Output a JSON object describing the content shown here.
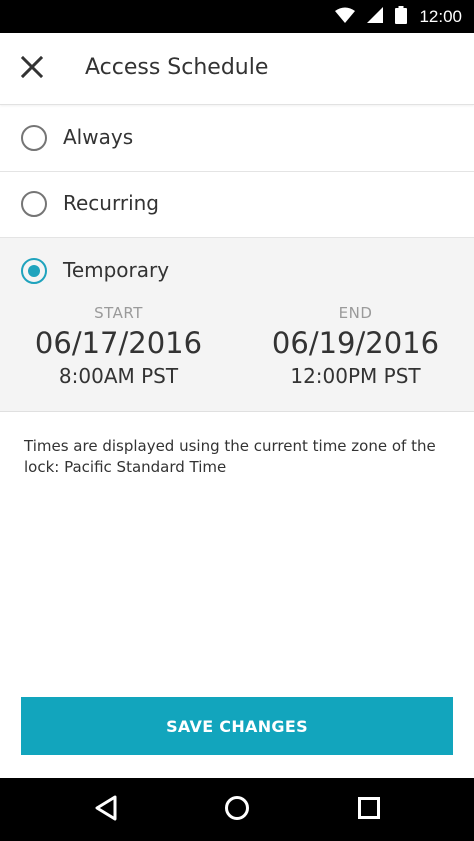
{
  "status_bar": {
    "time": "12:00",
    "icons": [
      "wifi-icon",
      "signal-icon",
      "battery-icon"
    ]
  },
  "app_bar": {
    "title": "Access Schedule",
    "close_icon": "close-icon"
  },
  "options": [
    {
      "label": "Always",
      "selected": false
    },
    {
      "label": "Recurring",
      "selected": false
    },
    {
      "label": "Temporary",
      "selected": true
    }
  ],
  "temporary": {
    "start": {
      "caption": "START",
      "date": "06/17/2016",
      "time": "8:00AM PST"
    },
    "end": {
      "caption": "END",
      "date": "06/19/2016",
      "time": "12:00PM PST"
    }
  },
  "note": "Times are displayed using the current time zone of the lock: Pacific Standard Time",
  "save_button": {
    "label": "SAVE CHANGES"
  },
  "nav_bar": {
    "icons": [
      "back-icon",
      "home-icon",
      "recents-icon"
    ]
  },
  "colors": {
    "accent": "#1fa3bd",
    "button": "#12a5bd",
    "section_bg": "#f4f4f4"
  }
}
